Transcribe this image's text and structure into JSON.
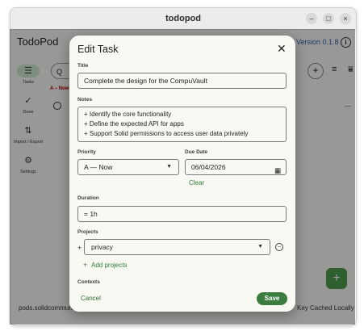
{
  "window": {
    "title": "todopod",
    "controls": [
      "–",
      "□",
      "×"
    ]
  },
  "app": {
    "name": "TodoPod",
    "version": "Version 0.1.8"
  },
  "sidebar": {
    "items": [
      {
        "label": "Tasks",
        "icon": "checklist-icon",
        "glyph": "☰"
      },
      {
        "label": "Done",
        "icon": "check-circle-icon",
        "glyph": "✓"
      },
      {
        "label": "Import / Export",
        "icon": "import-export-icon",
        "glyph": "⇅"
      },
      {
        "label": "Settings",
        "icon": "gear-icon",
        "glyph": "⚙"
      }
    ]
  },
  "background": {
    "search_glyph": "Q",
    "group_label": "A – Now",
    "footer_left": "pods.solidcommunit",
    "footer_right": "Key Cached Locally"
  },
  "dialog": {
    "title": "Edit Task",
    "title_label": "Title",
    "title_value": "Complete the design for the CompuVault",
    "notes_label": "Notes",
    "notes_lines": [
      "+ Identify the core functionality",
      "+ Define the expected API for apps",
      "+ Support Solid permissions to access user data privately"
    ],
    "priority_label": "Priority",
    "priority_value": "A — Now",
    "due_label": "Due Date",
    "due_value": "06/04/2026",
    "clear_label": "Clear",
    "duration_label": "Duration",
    "duration_value": "= 1h",
    "projects_label": "Projects",
    "project_value": "privacy",
    "add_projects_label": "Add projects",
    "contexts_label": "Contexts",
    "cancel_label": "Cancel",
    "save_label": "Save"
  },
  "colors": {
    "accent": "#3a7d3e",
    "link": "#2f7a33",
    "version": "#2a5db0",
    "scrim": "#000000"
  }
}
